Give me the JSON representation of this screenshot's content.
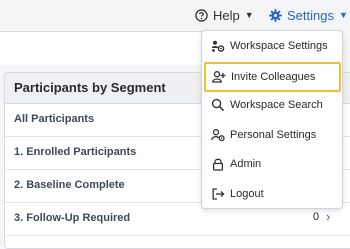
{
  "header": {
    "help_label": "Help",
    "settings_label": "Settings"
  },
  "panel": {
    "title": "Participants by Segment",
    "rows": [
      {
        "label": "All Participants",
        "count": ""
      },
      {
        "label": "1. Enrolled Participants",
        "count": ""
      },
      {
        "label": "2. Baseline Complete",
        "count": ""
      },
      {
        "label": "3. Follow-Up Required",
        "count": "0"
      }
    ]
  },
  "settings_menu": {
    "items": [
      {
        "label": "Workspace Settings",
        "icon": "workspace-settings-icon"
      },
      {
        "label": "Invite Colleagues",
        "icon": "invite-user-icon",
        "highlighted": true
      },
      {
        "label": "Workspace Search",
        "icon": "search-icon"
      },
      {
        "label": "Personal Settings",
        "icon": "personal-settings-icon"
      },
      {
        "label": "Admin",
        "icon": "lock-icon"
      },
      {
        "label": "Logout",
        "icon": "logout-icon"
      }
    ]
  },
  "colors": {
    "accent": "#2b66c2",
    "highlight_border": "#f2c12e",
    "panel_header_bg": "#eef0f3"
  }
}
